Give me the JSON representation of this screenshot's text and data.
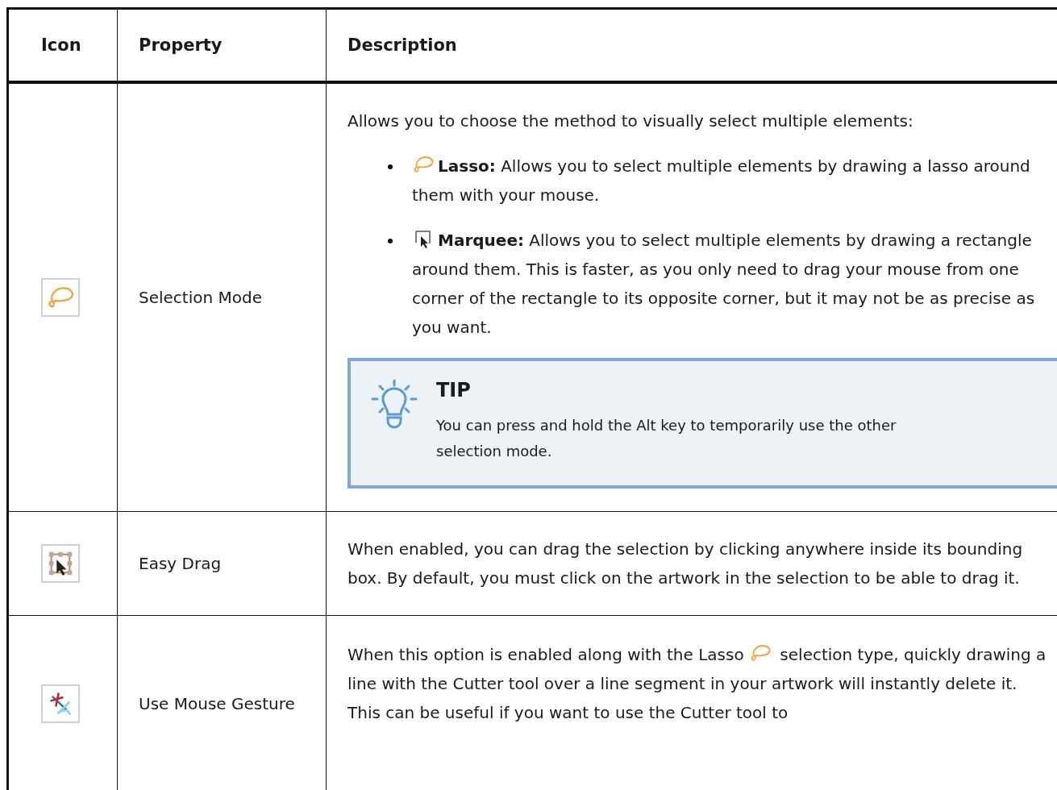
{
  "table": {
    "columns": [
      "Icon",
      "Property",
      "Description"
    ],
    "rows": [
      {
        "kind": "lasso",
        "property": "Selection Mode",
        "description": {
          "intro": "Allows you to choose the method to visually select multiple elements:",
          "bullets": [
            {
              "kind": "lasso",
              "label": "Lasso:",
              "text": "Allows you to select multiple elements by drawing a lasso around them with your mouse."
            },
            {
              "kind": "marquee",
              "label": "Marquee:",
              "text": "Allows you to select multiple elements by drawing a rectangle around them. This is faster, as you only need to drag your mouse from one corner of the rectangle to its opposite corner, but it may not be as precise as you want."
            }
          ],
          "tip": {
            "title": "TIP",
            "text": "You can press and hold the Alt key to temporarily use the other selection mode."
          }
        }
      },
      {
        "kind": "easy-drag",
        "property": "Easy Drag",
        "description": {
          "intro": "When enabled, you can drag the selection by clicking anywhere inside its bounding box. By default, you must click on the artwork in the selection to be able to drag it."
        }
      },
      {
        "kind": "mouse-gesture",
        "property": "Use Mouse Gesture",
        "description": {
          "segments": [
            {
              "kind": "text",
              "text": "When this option is enabled along with the Lasso"
            },
            {
              "kind": "lasso"
            },
            {
              "kind": "text",
              "text": "selection type, quickly drawing a line with the Cutter tool over a line segment in your artwork will instantly delete it. This can be useful if you want to use the Cutter tool to"
            }
          ]
        }
      }
    ]
  }
}
